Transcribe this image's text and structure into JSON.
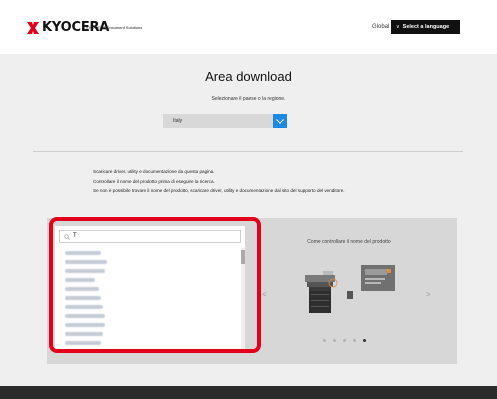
{
  "header": {
    "brand": "KYOCERA",
    "brand_sub": "KYOCERA Document Solutions",
    "global_label": "Global",
    "language_button": "Select a language",
    "brand_color": "#e3001b"
  },
  "main": {
    "title": "Area download",
    "subtitle": "Selezionare il paese o la regione.",
    "country_select": {
      "value": "Italy"
    },
    "info_lines": [
      "Scaricare driver, utility e documentazione da questa pagina.",
      "Controllare il nome del prodotto prima di eseguire la ricerca.",
      "Se non è possibile trovare il nome del prodotto, scaricare driver, utility e documentazione dal sito del supporto del venditore."
    ]
  },
  "search": {
    "query": "T",
    "result_count_visible": 11
  },
  "carousel": {
    "title": "Come controllare il nome del prodotto",
    "prev_icon": "chevron-left-icon",
    "next_icon": "chevron-right-icon",
    "slides_total": 5,
    "active_slide": 5
  },
  "colors": {
    "accent": "#1e88e5",
    "highlight": "#e3001b",
    "panel_bg": "#efefef",
    "footer_bg": "#2b2b2b"
  }
}
